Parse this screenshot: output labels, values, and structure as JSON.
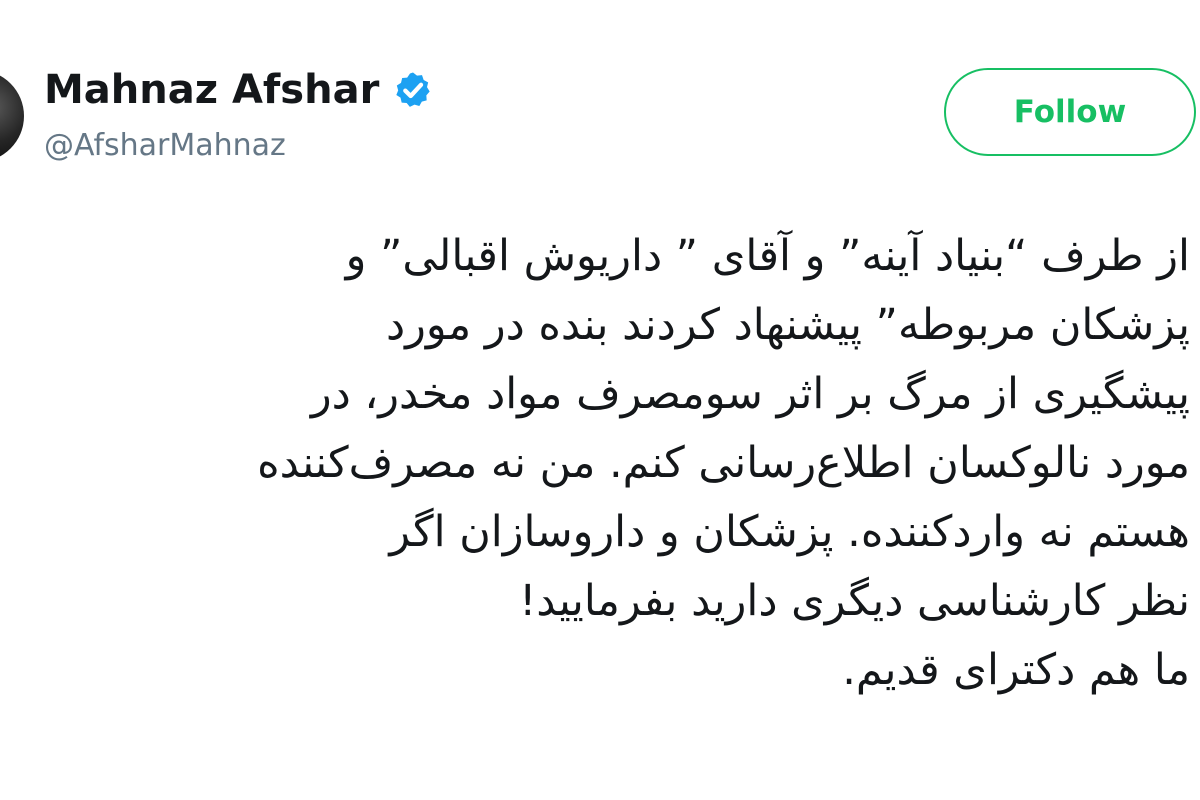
{
  "tweet": {
    "author": {
      "display_name": "Mahnaz Afshar",
      "handle": "@AfsharMahnaz",
      "verified": true,
      "avatar_icon": "user-avatar"
    },
    "follow_label": "Follow",
    "lines": [
      "از طرف “بنیاد آینه” و آقای ” داریوش اقبالی” و",
      "پزشکان مربوطه” پیشنهاد کردند بنده در مورد",
      "پیشگیری از مرگ بر اثر سومصرف مواد مخدر، در",
      "مورد نالوکسان اطلاع‌رسانی کنم. من نه مصرف‌کننده",
      "هستم نه واردکننده. پزشکان و داروسازان اگر",
      "نظر کارشناسی دیگری دارید بفرمایید!",
      "ما هم دکترای قدیم."
    ]
  },
  "colors": {
    "follow_green": "#17bf63",
    "verified_blue": "#1da1f2",
    "text_primary": "#14171a",
    "text_secondary": "#657786"
  }
}
